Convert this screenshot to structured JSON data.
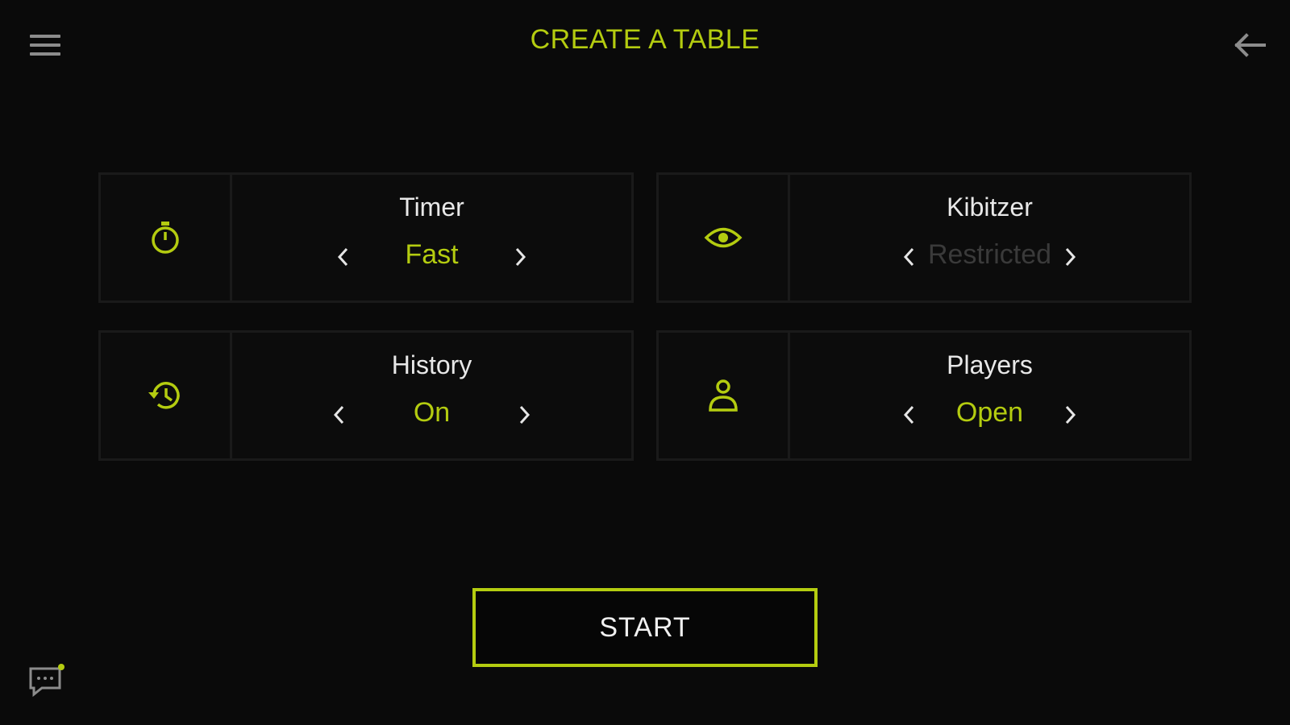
{
  "header": {
    "title": "CREATE A TABLE"
  },
  "settings": [
    {
      "label": "Timer",
      "value": "Fast",
      "icon": "stopwatch-icon",
      "active": true
    },
    {
      "label": "Kibitzer",
      "value": "Restricted",
      "icon": "eye-icon",
      "active": false
    },
    {
      "label": "History",
      "value": "On",
      "icon": "history-icon",
      "active": true
    },
    {
      "label": "Players",
      "value": "Open",
      "icon": "person-icon",
      "active": true
    }
  ],
  "actions": {
    "start_label": "START"
  },
  "colors": {
    "accent": "#b4cc10",
    "background": "#0a0a0a",
    "disabled": "#3a3a3a"
  }
}
